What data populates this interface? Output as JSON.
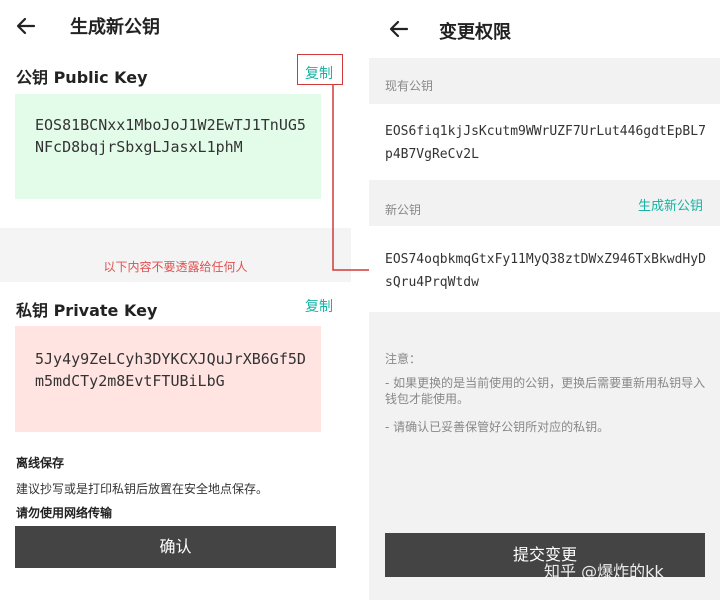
{
  "left": {
    "title": "生成新公钥",
    "public": {
      "label": "公钥 Public Key",
      "copy": "复制",
      "value": "EOS81BCNxx1MboJoJ1W2EwTJ1TnUG5NFcD8bqjrSbxgLJasxL1phM"
    },
    "warning": "以下内容不要透露给任何人",
    "private": {
      "label": "私钥 Private Key",
      "copy": "复制",
      "value": "5Jy4y9ZeLCyh3DYKCXJQuJrXB6Gf5Dm5mdCTy2m8EvtFTUBiLbG"
    },
    "offline_title": "离线保存",
    "offline_text": "建议抄写或是打印私钥后放置在安全地点保存。",
    "network_title": "请勿使用网络传输",
    "confirm": "确认"
  },
  "right": {
    "title": "变更权限",
    "current_label": "现有公钥",
    "current_key": "EOS6fiq1kjJsKcutm9WWrUZF7UrLut446gdtEpBL7p4B7VgReCv2L",
    "new_label": "新公钥",
    "generate": "生成新公钥",
    "new_key": "EOS74oqbkmqGtxFy11MyQ38ztDWxZ946TxBkwdHyDsQru4PrqWtdw",
    "notice_title": "注意：",
    "notice_1": "- 如果更换的是当前使用的公钥，更换后需要重新用私钥导入钱包才能使用。",
    "notice_2": "- 请确认已妥善保管好公钥所对应的私钥。",
    "submit": "提交变更"
  },
  "watermark": "知乎 @爆炸的kk",
  "colors": {
    "accent": "#17b3a3",
    "warning": "#e05050",
    "public_bg": "#e3fbe9",
    "private_bg": "#ffe4e2",
    "button": "#444444",
    "annotation": "#d23a3a"
  }
}
